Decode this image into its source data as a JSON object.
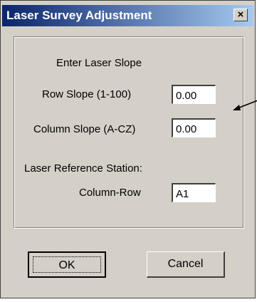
{
  "dialog": {
    "title": "Laser Survey Adjustment",
    "close_glyph": "×"
  },
  "form": {
    "heading": "Enter Laser  Slope",
    "row_slope_label": "Row  Slope (1-100)",
    "row_slope_value": "0.00",
    "column_slope_label": "Column Slope (A-CZ)",
    "column_slope_value": "0.00",
    "reference_heading": "Laser Reference Station:",
    "column_row_label": "Column-Row",
    "column_row_value": "A1"
  },
  "buttons": {
    "ok_label": "OK",
    "cancel_label": "Cancel"
  },
  "colors": {
    "titlebar_start": "#0a246a",
    "titlebar_end": "#a6caf0",
    "dialog_face": "#d4d0c8"
  },
  "icons": {
    "close": "close-icon",
    "pointer": "arrow-left-icon"
  }
}
